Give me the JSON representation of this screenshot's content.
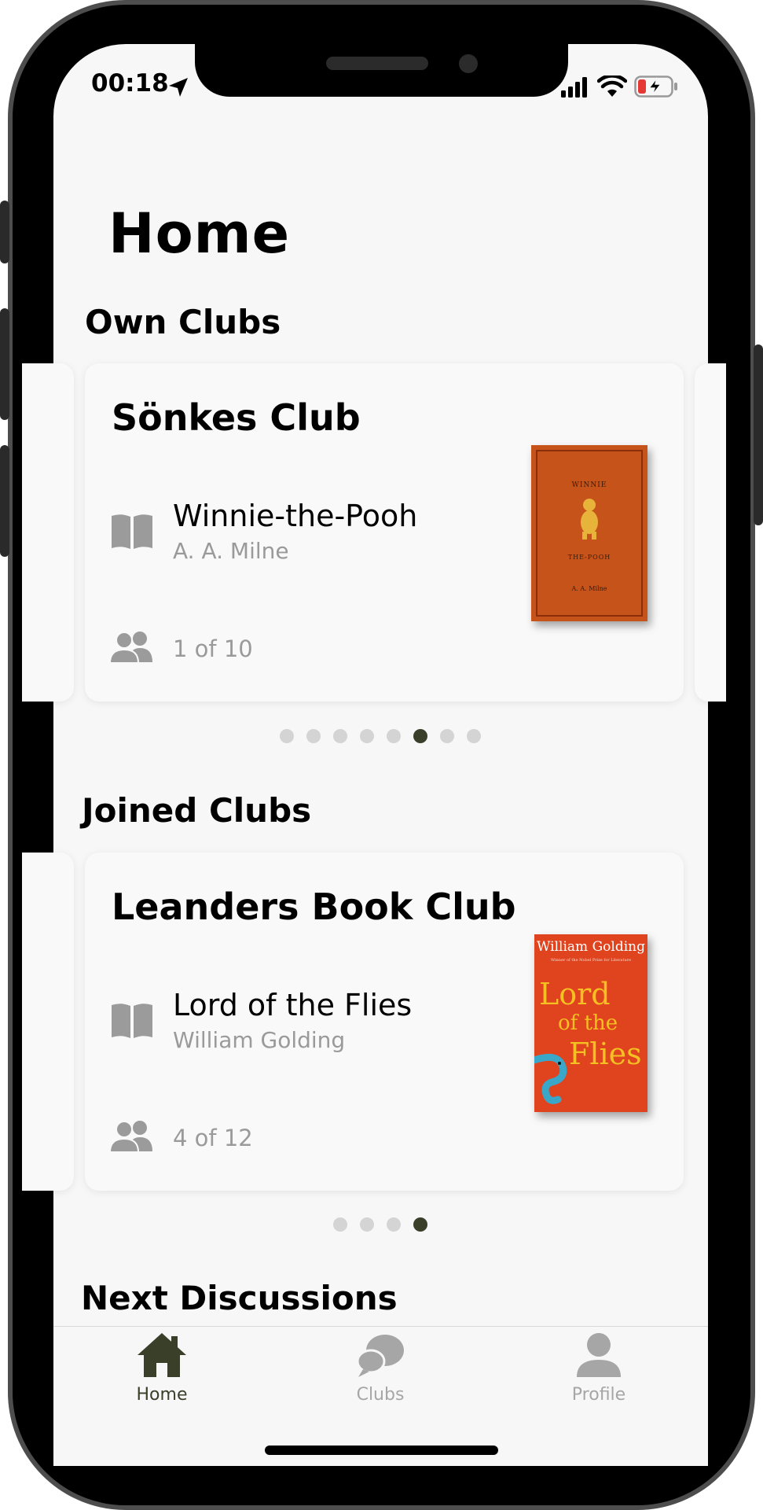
{
  "status_bar": {
    "time": "00:18"
  },
  "page_title": "Home",
  "own_clubs": {
    "section_title": "Own Clubs",
    "card": {
      "club_name": "Sönkes Club",
      "book_title": "Winnie-the-Pooh",
      "book_author": "A. A. Milne",
      "members": "1 of 10",
      "cover": {
        "top_text": "WINNIE",
        "bottom_text": "THE-POOH",
        "author_text": "A. A. Milne",
        "color": "#c5531a"
      }
    },
    "pagination": {
      "count": 8,
      "active": 5
    }
  },
  "joined_clubs": {
    "section_title": "Joined Clubs",
    "card": {
      "club_name": "Leanders Book Club",
      "book_title": "Lord of the Flies",
      "book_author": "William Golding",
      "members": "4 of 12",
      "cover": {
        "author": "William Golding",
        "tagline": "Winner of the Nobel Prize for Literature",
        "line1": "Lord",
        "line2": "of the",
        "line3": "Flies",
        "color": "#e0441f"
      }
    },
    "pagination": {
      "count": 4,
      "active": 3
    }
  },
  "next_discussions": {
    "section_title": "Next Discussions"
  },
  "tab_bar": {
    "home": "Home",
    "clubs": "Clubs",
    "profile": "Profile"
  },
  "colors": {
    "accent": "#3a3f2a",
    "inactive": "#a6a6a6",
    "card_bg": "#f9f9f9"
  }
}
